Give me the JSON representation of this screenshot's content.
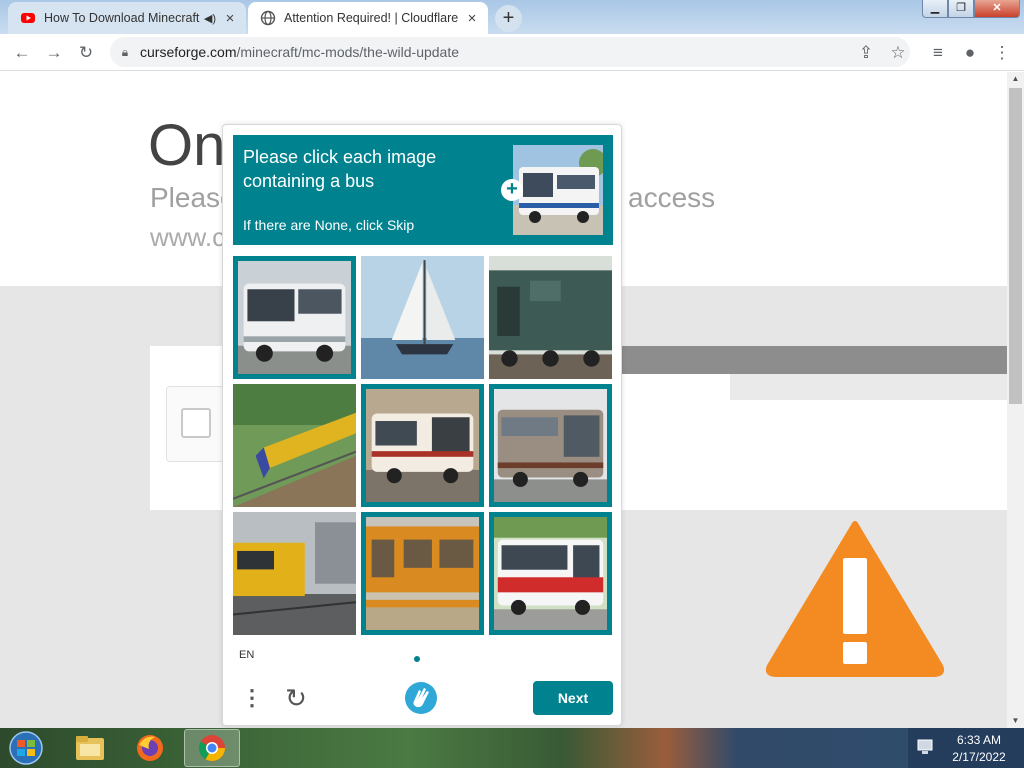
{
  "browser": {
    "tabs": [
      {
        "title": "How To Download Minecraft",
        "icon": "youtube-icon",
        "muted_icon": "speaker-icon"
      },
      {
        "title": "Attention Required! | Cloudflare",
        "icon": "globe-icon"
      }
    ],
    "new_tab_label": "+",
    "close_label": "×",
    "url_host": "curseforge.com",
    "url_path": "/minecraft/mc-mods/the-wild-update"
  },
  "page": {
    "heading": "On",
    "subline_start": "Please",
    "subline_end": "access",
    "domain": "www.c"
  },
  "captcha": {
    "prompt_title": "Please click each image containing a bus",
    "prompt_hint": "If there are None, click Skip",
    "language": "EN",
    "next_label": "Next",
    "accent_color": "#00838f",
    "tiles": [
      {
        "subject": "bus",
        "selected": true
      },
      {
        "subject": "sailboat",
        "selected": false
      },
      {
        "subject": "train",
        "selected": false
      },
      {
        "subject": "train",
        "selected": false
      },
      {
        "subject": "bus",
        "selected": true
      },
      {
        "subject": "bus",
        "selected": true
      },
      {
        "subject": "train",
        "selected": false
      },
      {
        "subject": "train",
        "selected": true
      },
      {
        "subject": "bus",
        "selected": true
      }
    ]
  },
  "taskbar": {
    "time": "6:33 AM",
    "date": "2/17/2022",
    "apps": [
      "explorer-icon",
      "firefox-icon",
      "chrome-icon"
    ]
  }
}
